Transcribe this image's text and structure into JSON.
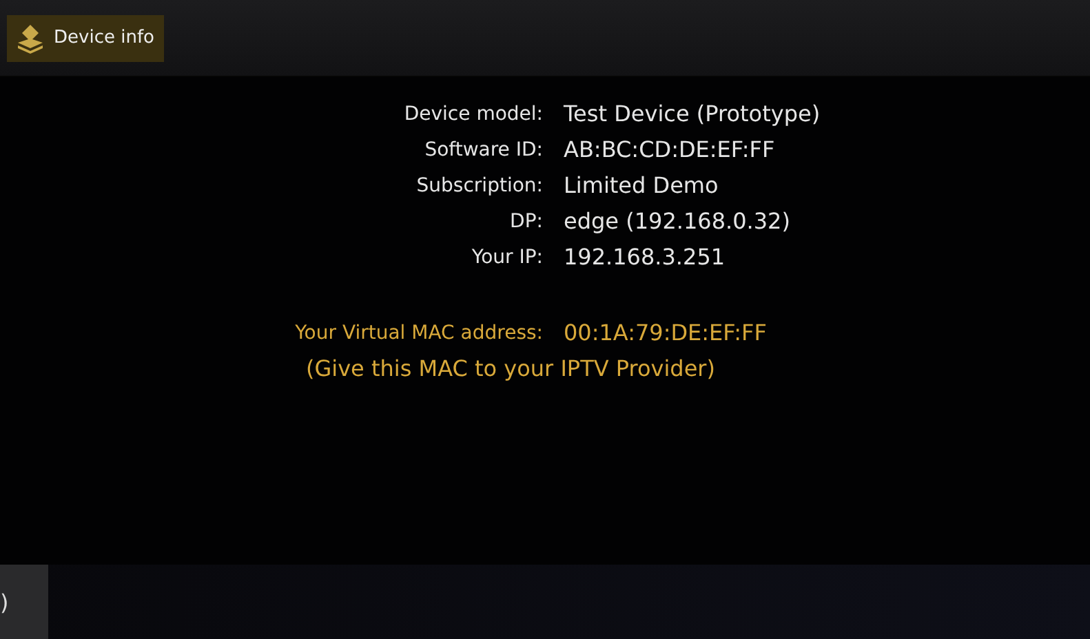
{
  "header": {
    "tab": {
      "label": "Device info",
      "selected": true
    }
  },
  "info_rows": [
    {
      "label": "Device model:",
      "value": "Test Device (Prototype)"
    },
    {
      "label": "Software ID:",
      "value": "AB:BC:CD:DE:EF:FF"
    },
    {
      "label": "Subscription:",
      "value": "Limited Demo"
    },
    {
      "label": "DP:",
      "value": "edge (192.168.0.32)"
    },
    {
      "label": "Your IP:",
      "value": "192.168.3.251"
    }
  ],
  "mac": {
    "label": "Your Virtual MAC address:",
    "value": "00:1A:79:DE:EF:FF",
    "note": "(Give this MAC to your IPTV Provider)"
  },
  "footer": {
    "button": ")"
  }
}
